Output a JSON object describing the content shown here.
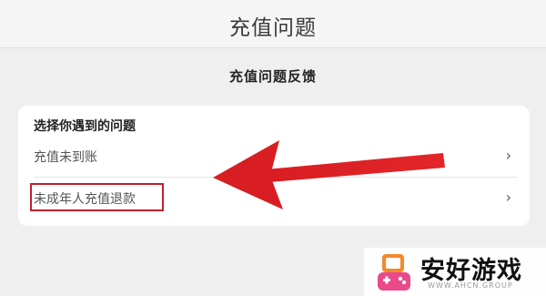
{
  "header": {
    "title": "充值问题"
  },
  "section": {
    "title": "充值问题反馈"
  },
  "card": {
    "title": "选择你遇到的问题",
    "items": [
      {
        "label": "充值未到账",
        "chevron": "›"
      },
      {
        "label": "未成年人充值退款",
        "chevron": "›"
      }
    ]
  },
  "annotation": {
    "color": "#c0202b"
  },
  "watermark": {
    "text": "安好游戏",
    "subtext": "WWW.AHCN.GROUP",
    "logo_icon": "game-console-icon"
  }
}
